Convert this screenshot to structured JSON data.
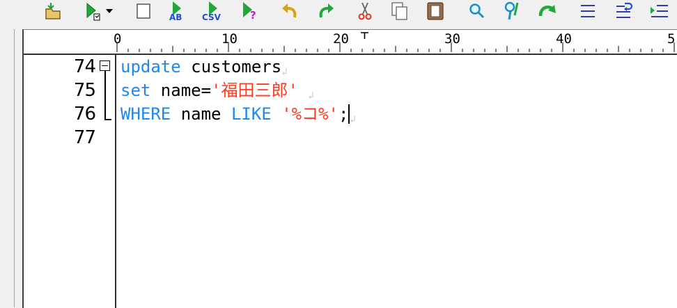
{
  "toolbar": {
    "buttons": [
      {
        "name": "open-folder-icon"
      },
      {
        "name": "run-dropdown-icon"
      },
      {
        "name": "blank-page-icon"
      },
      {
        "name": "run-ab-icon",
        "label": "AB"
      },
      {
        "name": "run-csv-icon",
        "label": "CSV"
      },
      {
        "name": "run-help-icon",
        "label": "?"
      },
      {
        "name": "undo-icon"
      },
      {
        "name": "redo-icon"
      },
      {
        "name": "cut-icon"
      },
      {
        "name": "copy-icon"
      },
      {
        "name": "paste-icon"
      },
      {
        "name": "find-icon"
      },
      {
        "name": "find-next-icon"
      },
      {
        "name": "goto-icon"
      },
      {
        "name": "align-icon"
      },
      {
        "name": "wrap-icon"
      },
      {
        "name": "indent-icon"
      }
    ]
  },
  "ruler": {
    "labels": [
      "0",
      "10",
      "20",
      "30",
      "40",
      "5"
    ]
  },
  "editor": {
    "line_numbers": [
      "74",
      "75",
      "76",
      "77"
    ],
    "lines": [
      [
        {
          "t": "update",
          "c": "kw"
        },
        {
          "t": " customers",
          "c": "id"
        }
      ],
      [
        {
          "t": "set",
          "c": "kw"
        },
        {
          "t": " name=",
          "c": "id"
        },
        {
          "t": "'福田三郎'",
          "c": "str"
        }
      ],
      [
        {
          "t": "WHERE",
          "c": "kw"
        },
        {
          "t": " name ",
          "c": "id"
        },
        {
          "t": "LIKE",
          "c": "kw"
        },
        {
          "t": " ",
          "c": "id"
        },
        {
          "t": "'%コ%'",
          "c": "str"
        },
        {
          "t": ";",
          "c": "id"
        }
      ]
    ],
    "eol_mark": "↲",
    "colors": {
      "keyword": "#1e88f0",
      "string": "#ff3b1f",
      "text": "#000000"
    }
  }
}
